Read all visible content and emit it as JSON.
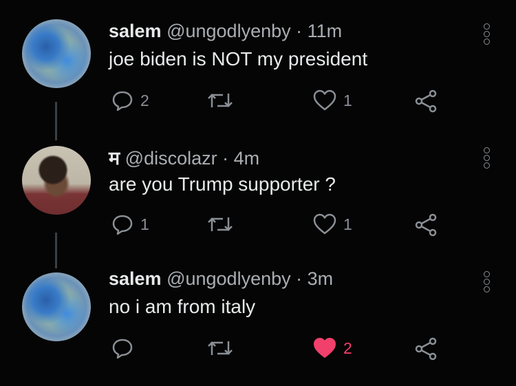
{
  "tweets": [
    {
      "name": "salem",
      "handle": "@ungodlyenby",
      "separator": "·",
      "time": "11m",
      "text": "joe biden is NOT my president",
      "replies": "2",
      "retweets": "",
      "likes": "1",
      "liked": false,
      "avatar_icon": "planet-avatar"
    },
    {
      "name": "म",
      "handle": "@discolazr",
      "separator": "·",
      "time": "4m",
      "text": "are you Trump supporter ?",
      "replies": "1",
      "retweets": "",
      "likes": "1",
      "liked": false,
      "avatar_icon": "person-selfie-avatar"
    },
    {
      "name": "salem",
      "handle": "@ungodlyenby",
      "separator": "·",
      "time": "3m",
      "text": "no i am from italy",
      "replies": "",
      "retweets": "",
      "likes": "2",
      "liked": true,
      "avatar_icon": "planet-avatar"
    }
  ],
  "colors": {
    "background": "#050505",
    "text": "#e7e9ea",
    "muted": "#8b9096",
    "like_active": "#f1406b"
  }
}
